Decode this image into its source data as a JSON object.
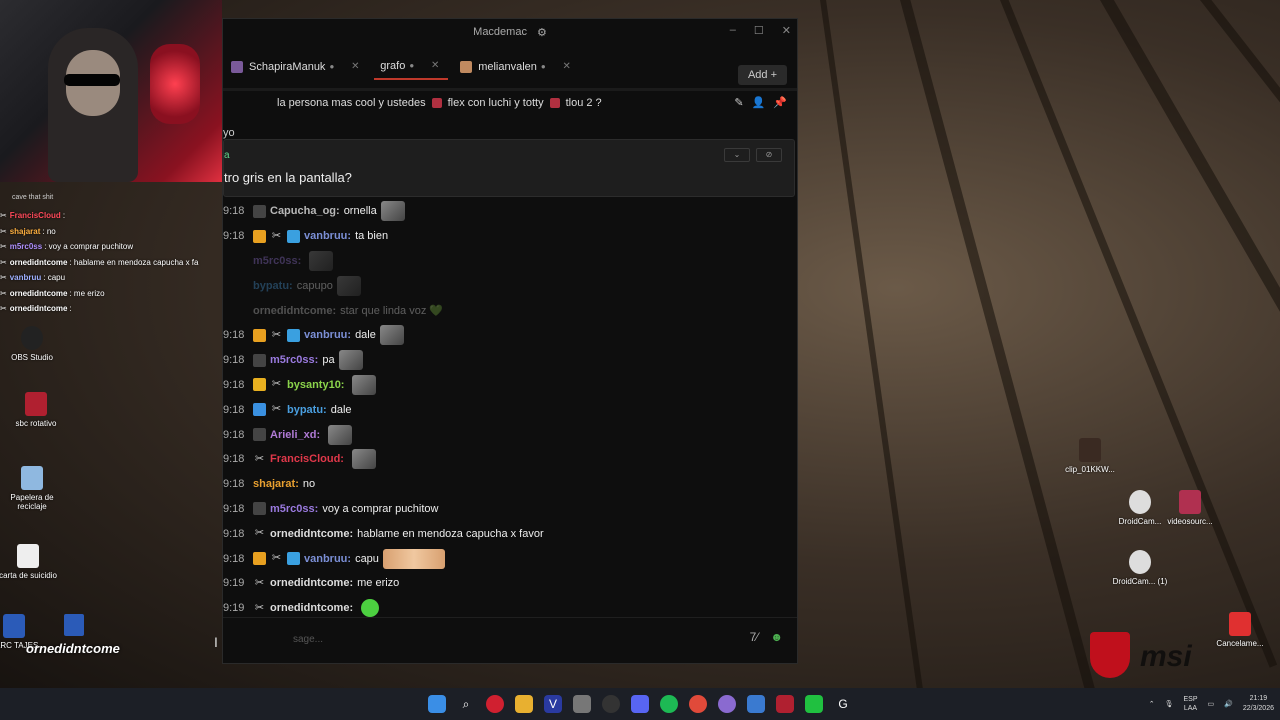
{
  "window": {
    "title": "Macdemac",
    "minimize": "–",
    "maximize": "☐",
    "close": "✕"
  },
  "tabs": [
    {
      "label": "SchapiraManuk",
      "dot": "●",
      "close": "✕"
    },
    {
      "label": "grafo",
      "dot": "●",
      "close": "✕"
    },
    {
      "label": "melianvalen",
      "dot": "●",
      "close": "✕"
    }
  ],
  "add_button": "Add  +",
  "pinbar": {
    "items": [
      "la persona mas cool y ustedes",
      "flex con luchi y totty",
      "tlou 2 ?"
    ],
    "partial_text": "yo"
  },
  "pinned_message": {
    "user": "a",
    "text": "tro gris en la pantalla?"
  },
  "colors": {
    "accent_red": "#c0392b",
    "chat_bg": "#0e0e0e"
  },
  "chat": [
    {
      "time": "9:18",
      "user": "Capucha_og:",
      "color": "#b8b8b8",
      "text": "ornella",
      "badges": [
        "mic"
      ],
      "emote": true
    },
    {
      "time": "9:18",
      "user": "vanbruu:",
      "color": "#7b8fd6",
      "text": "ta bien",
      "badges": [
        "gold",
        "mod",
        "cube"
      ],
      "emote": false
    },
    {
      "time": "",
      "user": "m5rc0ss:",
      "color": "#9a7adf",
      "text": "",
      "badges": [],
      "emote": true,
      "faded": true
    },
    {
      "time": "",
      "user": "bypatu:",
      "color": "#4a9fe0",
      "text": "capupo",
      "badges": [],
      "emote": true,
      "faded": true
    },
    {
      "time": "",
      "user": "ornedidntcome:",
      "color": "#ccc",
      "text": "star que linda voz 💚",
      "badges": [],
      "emote": false,
      "faded": true
    },
    {
      "time": "9:18",
      "user": "vanbruu:",
      "color": "#7b8fd6",
      "text": "dale",
      "badges": [
        "gold",
        "mod",
        "cube"
      ],
      "emote": true
    },
    {
      "time": "9:18",
      "user": "m5rc0ss:",
      "color": "#9a7adf",
      "text": "pa",
      "badges": [
        "mic"
      ],
      "emote": true
    },
    {
      "time": "9:18",
      "user": "bysanty10:",
      "color": "#8bd44b",
      "text": "",
      "badges": [
        "crown",
        "mod"
      ],
      "emote": true
    },
    {
      "time": "9:18",
      "user": "bypatu:",
      "color": "#4a9fe0",
      "text": "dale",
      "badges": [
        "prime",
        "mod"
      ],
      "emote": false
    },
    {
      "time": "9:18",
      "user": "Arieli_xd:",
      "color": "#b07ad6",
      "text": "",
      "badges": [
        "mic"
      ],
      "emote": true
    },
    {
      "time": "9:18",
      "user": "FrancisCloud:",
      "color": "#e0384a",
      "text": "",
      "badges": [
        "mod"
      ],
      "emote": true
    },
    {
      "time": "9:18",
      "user": "shajarat:",
      "color": "#e8a030",
      "text": "no",
      "badges": [],
      "emote": false
    },
    {
      "time": "9:18",
      "user": "m5rc0ss:",
      "color": "#9a7adf",
      "text": "voy a comprar puchitow",
      "badges": [
        "mic"
      ],
      "emote": false
    },
    {
      "time": "9:18",
      "user": "ornedidntcome:",
      "color": "#ddd",
      "text": "hablame en mendoza capucha x favor",
      "badges": [
        "mod"
      ],
      "emote": false
    },
    {
      "time": "9:18",
      "user": "vanbruu:",
      "color": "#7b8fd6",
      "text": "capu",
      "badges": [
        "gold",
        "mod",
        "cube"
      ],
      "emote": true,
      "wide": true
    },
    {
      "time": "9:19",
      "user": "ornedidntcome:",
      "color": "#ddd",
      "text": "me erizo",
      "badges": [
        "mod"
      ],
      "emote": false
    },
    {
      "time": "9:19",
      "user": "ornedidntcome:",
      "color": "#ddd",
      "text": "",
      "badges": [
        "mod"
      ],
      "emote": true,
      "green": true
    }
  ],
  "input": {
    "placeholder": "sage..."
  },
  "overlay": {
    "title": "cave that shit",
    "lines": [
      {
        "user": "FrancisCloud",
        "color": "#ff4a5a",
        "text": ":"
      },
      {
        "user": "shajarat",
        "color": "#ffb040",
        "text": ": no"
      },
      {
        "user": "m5rc0ss",
        "color": "#b090ff",
        "text": ": voy a comprar puchitow"
      },
      {
        "user": "ornedidntcome",
        "color": "#fff",
        "text": ": hablame en mendoza capucha x fa"
      },
      {
        "user": "vanbruu",
        "color": "#9fb0ff",
        "text": ": capu"
      },
      {
        "user": "ornedidntcome",
        "color": "#fff",
        "text": ": me erizo"
      },
      {
        "user": "ornedidntcome",
        "color": "#fff",
        "text": ":"
      }
    ],
    "watermark": "ornedidntcome"
  },
  "desktop_icons": [
    {
      "label": "OBS Studio"
    },
    {
      "label": "sbc rotativo"
    },
    {
      "label": "Papelera de reciclaje"
    },
    {
      "label": "carta de suicidio"
    },
    {
      "label": "BARC TAJES"
    },
    {
      "label": "clip_01KKW..."
    },
    {
      "label": "DroidCam..."
    },
    {
      "label": "videosourc..."
    },
    {
      "label": "DroidCam... (1)"
    },
    {
      "label": "Cancelame..."
    }
  ],
  "tray": {
    "lang1": "ESP",
    "lang2": "LAA",
    "time": "21:19",
    "date": "22/3/2026"
  }
}
